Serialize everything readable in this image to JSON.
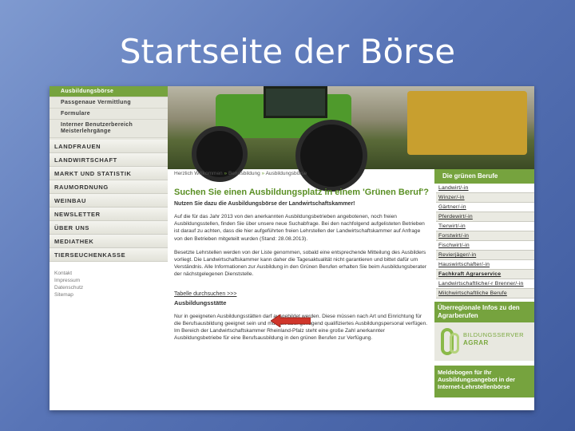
{
  "slide": {
    "title": "Startseite der Börse"
  },
  "sidebar": {
    "subnav": [
      "Ausbildungsbörse",
      "Passgenaue Vermittlung",
      "Formulare",
      "Interner Benutzerbereich Meisterlehrgänge"
    ],
    "mainnav": [
      "LANDFRAUEN",
      "LANDWIRTSCHAFT",
      "MARKT UND STATISTIK",
      "RAUMORDNUNG",
      "WEINBAU",
      "NEWSLETTER",
      "ÜBER UNS",
      "MEDIATHEK",
      "TIERSEUCHENKASSE"
    ],
    "footnav": [
      "Kontakt",
      "Impressum",
      "Datenschutz",
      "Sitemap"
    ]
  },
  "breadcrumb": {
    "home": "Herzlich Willkommen",
    "sep1": "»",
    "level2": "Berufsbildung",
    "sep2": "»",
    "level3": "Ausbildungsbörse"
  },
  "content": {
    "heading": "Suchen Sie einen Ausbildungsplatz in einem 'Grünen Beruf'?",
    "lead": "Nutzen Sie dazu die Ausbildungsbörse der Landwirtschaftskammer!",
    "p1": "Auf die für das Jahr 2013 von den anerkannten Ausbildungsbetrieben angebotenen, noch freien Ausbildungsstellen, finden Sie über unsere neue Suchabfrage. Bei den nachfolgend aufgelisteten Betrieben ist darauf zu achten, dass die hier aufgeführten freien Lehrstellen der Landwirtschaftskammer auf Anfrage von den Betrieben mitgeteilt wurden (Stand: 28.08.2013).",
    "p2": "Besetzte Lehrstellen werden von der Liste genommen, sobald eine entsprechende Mitteilung des Ausbilders vorliegt. Die Landwirtschaftskammer kann daher die Tagesaktualität nicht garantieren und bittet dafür um Verständnis. Alle Informationen zur Ausbildung in den Grünen Berufen erhalten Sie beim Ausbildungsberater der nächstgelegenen Dienststelle.",
    "table_link": "Tabelle durchsuchen >>>",
    "h2": "Ausbildungsstätte",
    "p3": "Nur in geeigneten Ausbildungsstätten darf ausgebildet werden. Diese müssen nach Art und Einrichtung für die Berufsausbildung geeignet sein und müssen über genügend qualifiziertes Ausbildungspersonal verfügen. Im Bereich der Landwirtschaftskammer Rheinland-Pfalz steht eine große Zahl anerkannter Ausbildungsbetriebe für eine Berufsausbildung in den grünen Berufen zur Verfügung."
  },
  "rightcol": {
    "header": "Die grünen Berufe",
    "items": [
      "Landwirt/-in",
      "Winzer/-in",
      "Gärtner/-in",
      "Pferdewirt/-in",
      "Tierwirt/-in",
      "Forstwirt/-in",
      "Fischwirt/-in",
      "Revierjäger/-in",
      "Hauswirtschafter/-in",
      "Fachkraft Agrarservice",
      "Landwirtschaftliche/-r Brenner/-in",
      "Milchwirtschaftliche Berufe"
    ],
    "box2": "Überregionale Infos zu den Agrarberufen",
    "logo_line1": "BILDUNGSSERVER",
    "logo_line2": "AGRAR",
    "box3": "Meldebogen für Ihr Ausbildungsangebot in der Internet-Lehrstellenbörse"
  },
  "colors": {
    "accent_green": "#76a33e",
    "heading_green": "#5a8f24",
    "arrow_red": "#d0362b"
  }
}
